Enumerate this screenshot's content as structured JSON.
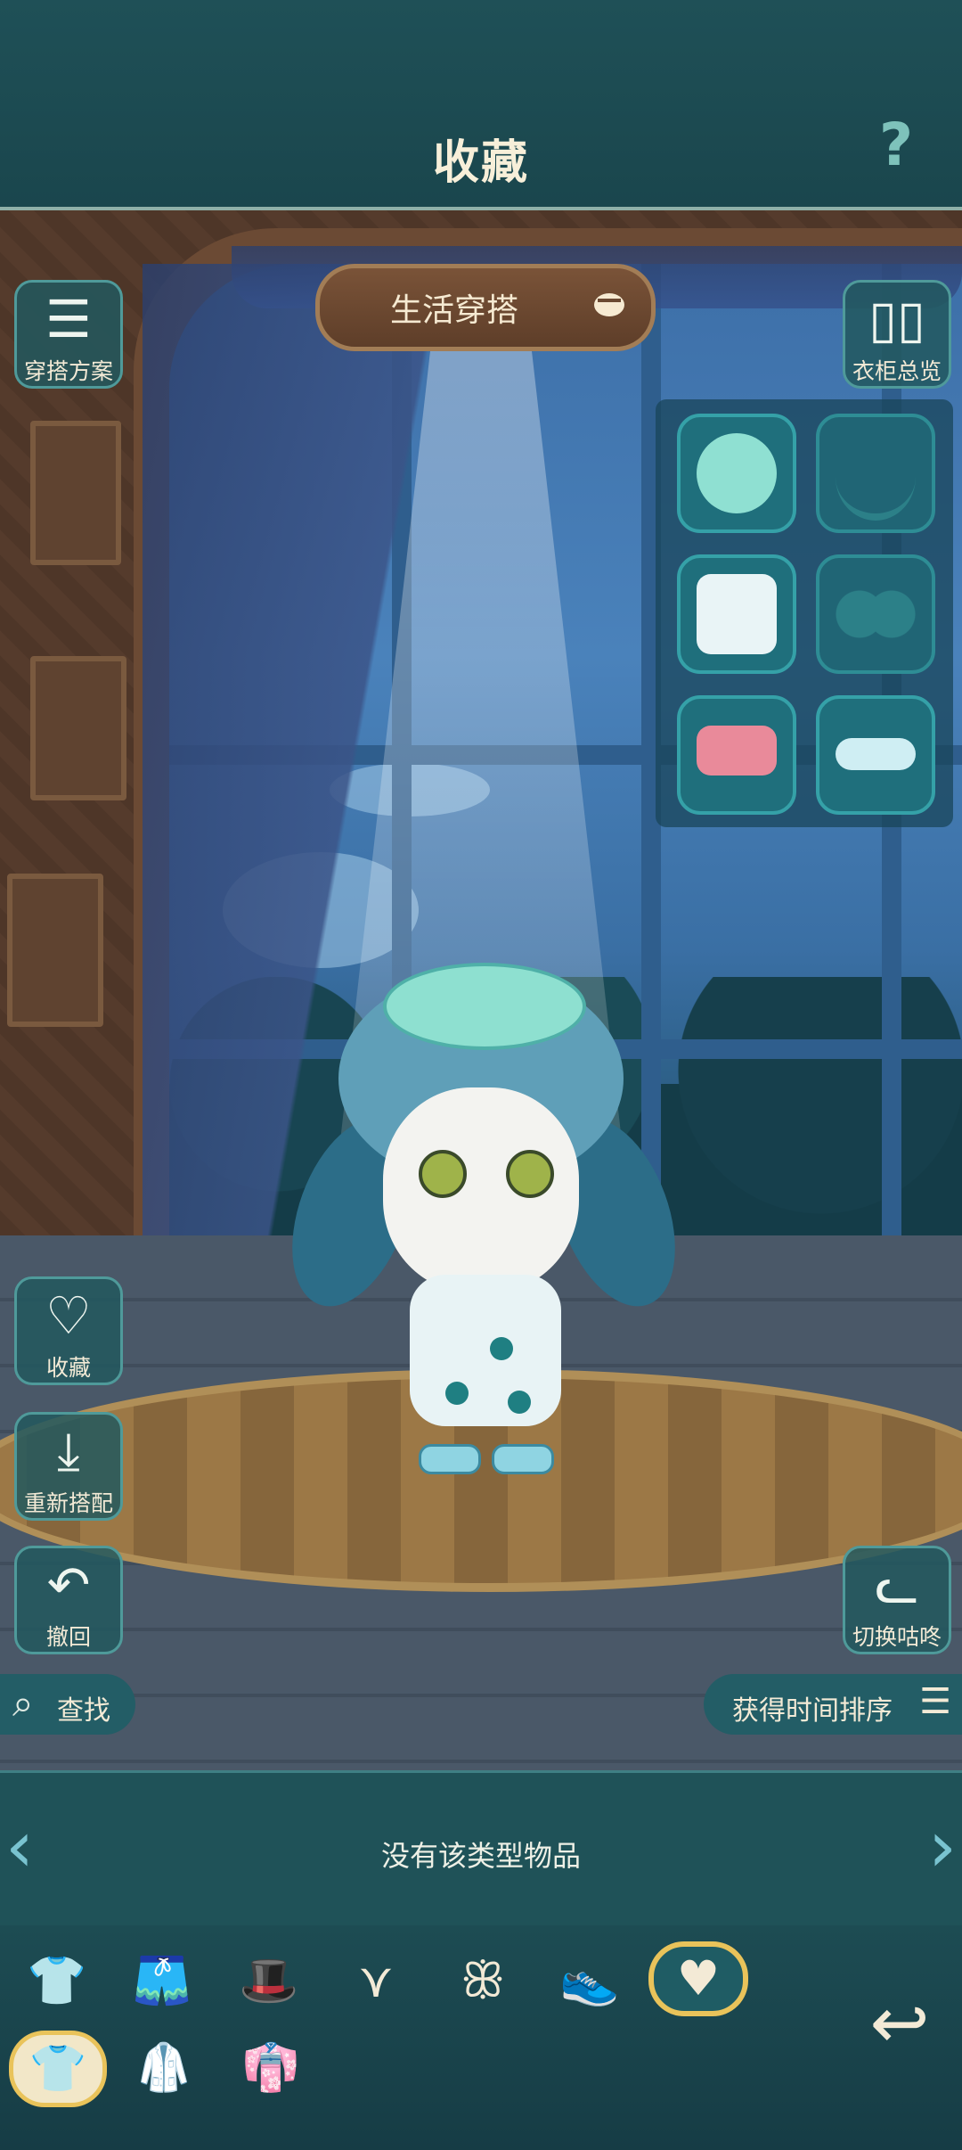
{
  "header": {
    "title": "收藏",
    "help_icon": "?"
  },
  "sign": {
    "label": "生活穿搭"
  },
  "left_buttons": {
    "outfit_plans": "穿搭方案",
    "favorite": "收藏",
    "rematch": "重新搭配",
    "undo": "撤回"
  },
  "right_buttons": {
    "wardrobe_overview": "衣柜总览",
    "switch_character": "切换咕咚"
  },
  "equipped_slots": [
    {
      "name": "hat",
      "filled": true,
      "color": "#8fe0d2"
    },
    {
      "name": "necklace",
      "filled": false
    },
    {
      "name": "top",
      "filled": true,
      "color": "#e9f4f6"
    },
    {
      "name": "wings",
      "filled": false
    },
    {
      "name": "pants",
      "filled": true,
      "color": "#e98a9a"
    },
    {
      "name": "shoes",
      "filled": true,
      "color": "#cfeef3"
    }
  ],
  "filters": {
    "search_label": "查找",
    "sort_label": "获得时间排序"
  },
  "list": {
    "empty_message": "没有该类型物品"
  },
  "categories_row1": [
    "shirt-icon",
    "shorts-icon",
    "hat-icon",
    "necklace-icon",
    "wings-icon",
    "shoes-icon",
    "heart-icon"
  ],
  "categories_row2": [
    "pet-outfit-icon",
    "suit-icon",
    "set-icon"
  ],
  "colors": {
    "accent": "#e9c35a",
    "panel": "#1f5258",
    "teal": "#35a1a8"
  }
}
